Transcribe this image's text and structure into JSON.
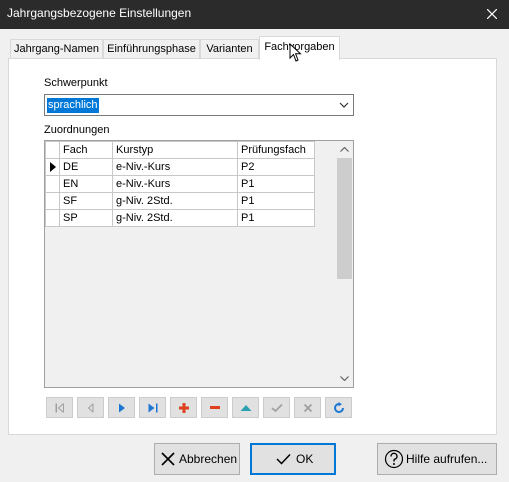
{
  "window": {
    "title": "Jahrgangsbezogene Einstellungen"
  },
  "tabs": [
    {
      "label": "Jahrgang-Namen",
      "active": false
    },
    {
      "label": "Einführungsphase",
      "active": false
    },
    {
      "label": "Varianten",
      "active": false
    },
    {
      "label": "Fachvorgaben",
      "active": true
    }
  ],
  "schwerpunkt": {
    "label": "Schwerpunkt",
    "value": "sprachlich"
  },
  "zuordnungen": {
    "label": "Zuordnungen",
    "columns": [
      "Fach",
      "Kurstyp",
      "Prüfungsfach"
    ],
    "rows": [
      {
        "fach": "DE",
        "kurstyp": "e-Niv.-Kurs",
        "pruefungsfach": "P2",
        "current": true
      },
      {
        "fach": "EN",
        "kurstyp": "e-Niv.-Kurs",
        "pruefungsfach": "P1",
        "current": false
      },
      {
        "fach": "SF",
        "kurstyp": "g-Niv. 2Std.",
        "pruefungsfach": "P1",
        "current": false
      },
      {
        "fach": "SP",
        "kurstyp": "g-Niv. 2Std.",
        "pruefungsfach": "P1",
        "current": false
      }
    ]
  },
  "navigator": [
    {
      "icon": "first-record-icon",
      "enabled": false
    },
    {
      "icon": "prior-record-icon",
      "enabled": false
    },
    {
      "icon": "next-record-icon",
      "enabled": true
    },
    {
      "icon": "last-record-icon",
      "enabled": true
    },
    {
      "icon": "insert-record-icon",
      "enabled": true
    },
    {
      "icon": "delete-record-icon",
      "enabled": true
    },
    {
      "icon": "edit-record-icon",
      "enabled": true
    },
    {
      "icon": "post-record-icon",
      "enabled": false
    },
    {
      "icon": "cancel-record-icon",
      "enabled": false
    },
    {
      "icon": "refresh-record-icon",
      "enabled": true
    }
  ],
  "buttons": {
    "cancel": "Abbrechen",
    "ok": "OK",
    "help": "Hilfe aufrufen..."
  },
  "colors": {
    "accent": "#0078d7",
    "nav_blue": "#1e78d2",
    "nav_red": "#e04020",
    "nav_teal": "#2aa0b0",
    "disabled": "#a0a0a0"
  }
}
